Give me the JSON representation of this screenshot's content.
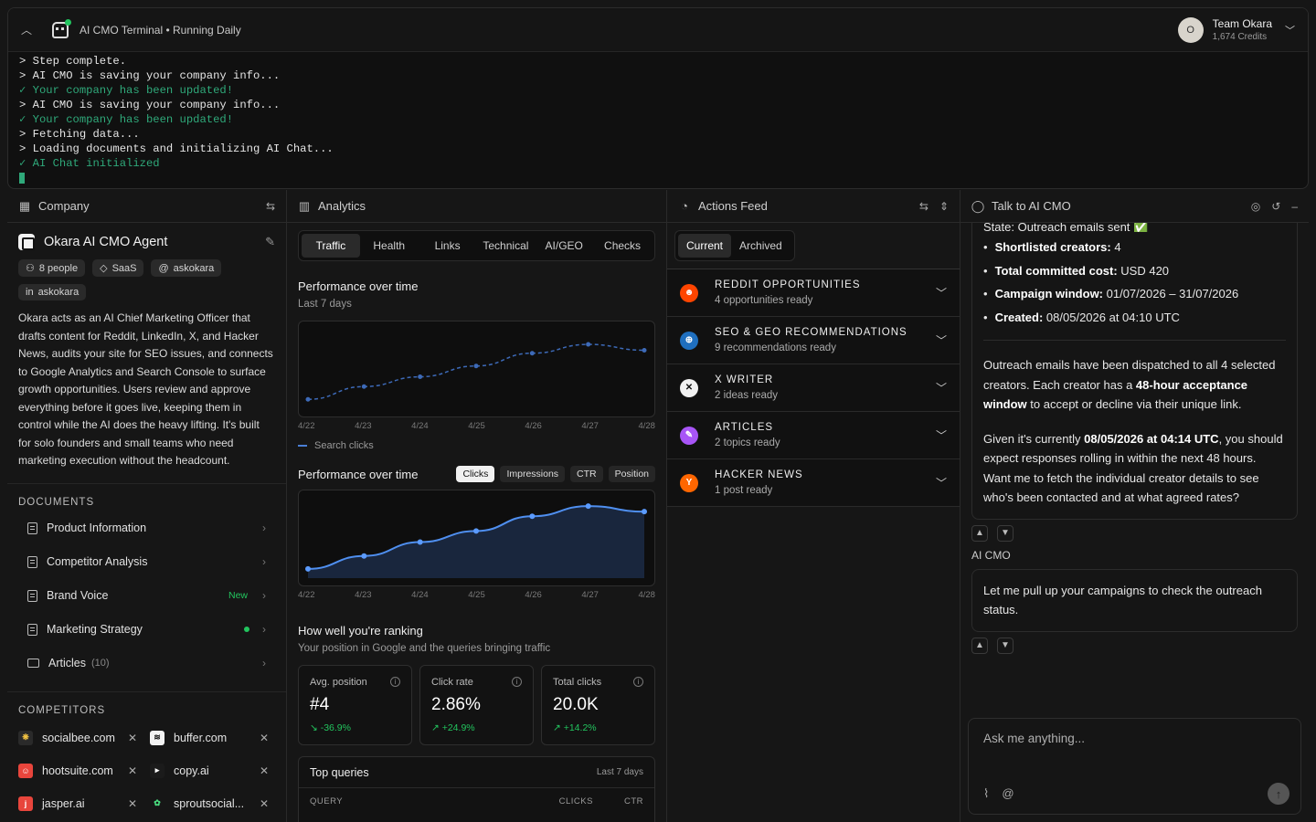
{
  "terminal": {
    "title": "AI CMO Terminal • Running Daily",
    "lines": [
      {
        "text": "> Step complete.",
        "ok": false
      },
      {
        "text": "> AI CMO is saving your company info...",
        "ok": false
      },
      {
        "text": "✓ Your company has been updated!",
        "ok": true
      },
      {
        "text": "> AI CMO is saving your company info...",
        "ok": false
      },
      {
        "text": "✓ Your company has been updated!",
        "ok": true
      },
      {
        "text": "> Fetching data...",
        "ok": false
      },
      {
        "text": "> Loading documents and initializing AI Chat...",
        "ok": false
      },
      {
        "text": "✓ AI Chat initialized",
        "ok": true
      }
    ]
  },
  "account": {
    "initial": "O",
    "name": "Team Okara",
    "credits": "1,674 Credits"
  },
  "company": {
    "header": "Company",
    "agent_name": "Okara AI CMO Agent",
    "chips": [
      {
        "icon": "people-icon",
        "glyph": "⚇",
        "label": "8 people"
      },
      {
        "icon": "tag-icon",
        "glyph": "◇",
        "label": "SaaS"
      },
      {
        "icon": "at-icon",
        "glyph": "@",
        "label": "askokara"
      },
      {
        "icon": "linkedin-icon",
        "glyph": "in",
        "label": "askokara"
      }
    ],
    "description": "Okara acts as an AI Chief Marketing Officer that drafts content for Reddit, LinkedIn, X, and Hacker News, audits your site for SEO issues, and connects to Google Analytics and Search Console to surface growth opportunities. Users review and approve everything before it goes live, keeping them in control while the AI does the heavy lifting. It's built for solo founders and small teams who need marketing execution without the headcount.",
    "documents_label": "DOCUMENTS",
    "documents": [
      {
        "label": "Product Information",
        "badge": "",
        "dot": false
      },
      {
        "label": "Competitor Analysis",
        "badge": "",
        "dot": false
      },
      {
        "label": "Brand Voice",
        "badge": "New",
        "dot": false
      },
      {
        "label": "Marketing Strategy",
        "badge": "",
        "dot": true
      }
    ],
    "articles": {
      "label": "Articles",
      "count": "(10)"
    },
    "competitors_label": "COMPETITORS",
    "competitors": [
      {
        "name": "socialbee.com",
        "bg": "#2a2a2a",
        "fg": "#f5c542",
        "glyph": "❋"
      },
      {
        "name": "buffer.com",
        "bg": "#f2f2f2",
        "fg": "#111",
        "glyph": "≋"
      },
      {
        "name": "hootsuite.com",
        "bg": "#e8453c",
        "fg": "#fff",
        "glyph": "☺"
      },
      {
        "name": "copy.ai",
        "bg": "#1b1b1b",
        "fg": "#fff",
        "glyph": "▸"
      },
      {
        "name": "jasper.ai",
        "bg": "#e8453c",
        "fg": "#fff",
        "glyph": "j"
      },
      {
        "name": "sproutsocial...",
        "bg": "#161616",
        "fg": "#4ade80",
        "glyph": "✿"
      }
    ]
  },
  "analytics": {
    "header": "Analytics",
    "tabs": [
      "Traffic",
      "Health",
      "Links",
      "Technical",
      "AI/GEO",
      "Checks"
    ],
    "perf1_title": "Performance over time",
    "perf1_caption": "Last 7 days",
    "legend": "Search clicks",
    "perf2_title": "Performance over time",
    "metric_pills": [
      "Clicks",
      "Impressions",
      "CTR",
      "Position"
    ],
    "ranking_title": "How well you're ranking",
    "ranking_caption": "Your position in Google and the queries bringing traffic",
    "kpis": [
      {
        "label": "Avg. position",
        "value": "#4",
        "delta": "↘ -36.9%",
        "color": "#22c55e"
      },
      {
        "label": "Click rate",
        "value": "2.86%",
        "delta": "↗ +24.9%",
        "color": "#22c55e"
      },
      {
        "label": "Total clicks",
        "value": "20.0K",
        "delta": "↗ +14.2%",
        "color": "#22c55e"
      }
    ],
    "queries": {
      "title": "Top queries",
      "range": "Last 7 days",
      "col_query": "QUERY",
      "col_clicks": "CLICKS",
      "col_ctr": "CTR"
    }
  },
  "chart_data": [
    {
      "type": "line",
      "title": "Performance over time",
      "style": "dashed",
      "x": [
        "4/22",
        "4/23",
        "4/24",
        "4/25",
        "4/26",
        "4/27",
        "4/28"
      ],
      "series": [
        {
          "name": "Search clicks",
          "values": [
            10,
            23,
            33,
            44,
            57,
            66,
            60
          ]
        }
      ],
      "ylim": [
        0,
        80
      ],
      "grid": false
    },
    {
      "type": "area",
      "title": "Performance over time",
      "x": [
        "4/22",
        "4/23",
        "4/24",
        "4/25",
        "4/26",
        "4/27",
        "4/28"
      ],
      "series": [
        {
          "values": [
            10,
            24,
            39,
            51,
            67,
            78,
            72
          ]
        }
      ],
      "ylim": [
        0,
        85
      ],
      "grid": false
    }
  ],
  "actions": {
    "header": "Actions Feed",
    "segments": [
      "Current",
      "Archived"
    ],
    "items": [
      {
        "title": "REDDIT OPPORTUNITIES",
        "sub": "4 opportunities ready",
        "icon": "reddit-icon",
        "bg": "#ff4500",
        "fg": "#fff",
        "glyph": "☻"
      },
      {
        "title": "SEO & GEO RECOMMENDATIONS",
        "sub": "9 recommendations ready",
        "icon": "globe-icon",
        "bg": "#1f6fbf",
        "fg": "#fff",
        "glyph": "⊕"
      },
      {
        "title": "X WRITER",
        "sub": "2 ideas ready",
        "icon": "x-icon",
        "bg": "#f2f2f2",
        "fg": "#111",
        "glyph": "✕"
      },
      {
        "title": "ARTICLES",
        "sub": "2 topics ready",
        "icon": "pen-icon",
        "bg": "#a855f7",
        "fg": "#fff",
        "glyph": "✎"
      },
      {
        "title": "HACKER NEWS",
        "sub": "1 post ready",
        "icon": "hackernews-icon",
        "bg": "#ff6600",
        "fg": "#fff",
        "glyph": "Y"
      }
    ]
  },
  "chat": {
    "header": "Talk to AI CMO",
    "partial_line": "State: Outreach emails sent ✅",
    "bullets": [
      {
        "k": "Shortlisted creators:",
        "v": " 4"
      },
      {
        "k": "Total committed cost:",
        "v": " USD 420"
      },
      {
        "k": "Campaign window:",
        "v": " 01/07/2026 – 31/07/2026"
      },
      {
        "k": "Created:",
        "v": " 08/05/2026 at 04:10 UTC"
      }
    ],
    "para1_a": "Outreach emails have been dispatched to all 4 selected creators. Each creator has a ",
    "para1_b": "48-hour acceptance window",
    "para1_c": " to accept or decline via their unique link.",
    "para2_a": "Given it's currently ",
    "para2_b": "08/05/2026 at 04:14 UTC",
    "para2_c": ", you should expect responses rolling in within the next 48 hours. Want me to fetch the individual creator details to see who's been contacted and at what agreed rates?",
    "sender": "AI CMO",
    "msg2": "Let me pull up your campaigns to check the outreach status.",
    "input_placeholder": "Ask me anything..."
  }
}
